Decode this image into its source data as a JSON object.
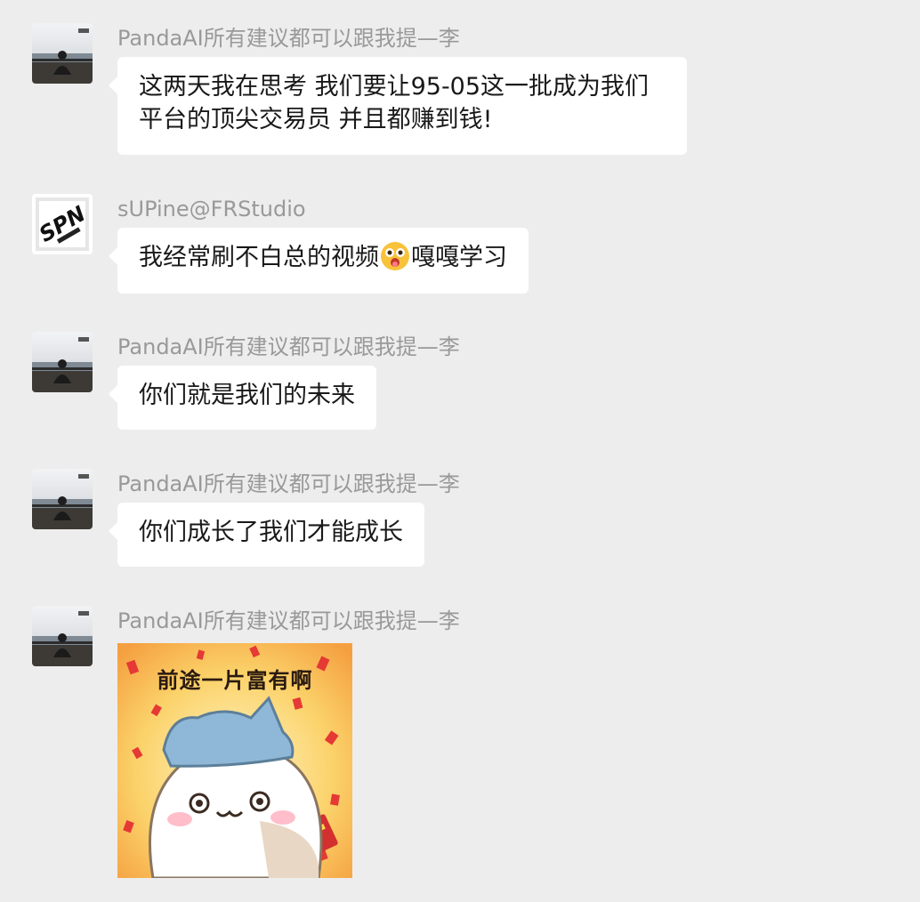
{
  "colors": {
    "background": "#ededed",
    "bubble": "#ffffff",
    "sender_name": "#999999",
    "message_text": "#191919"
  },
  "messages": [
    {
      "sender": "PandaAI所有建议都可以跟我提—李",
      "avatar": "photo-avatar-man-seaside",
      "text": "这两天我在思考 我们要让95-05这一批成为我们\n平台的顶尖交易员 并且都赚到钱!"
    },
    {
      "sender": "sUPine@FRStudio",
      "avatar": "spn-logo-avatar",
      "text_before": "我经常刷不白总的视频",
      "emoji": "drooling-face-emoji",
      "text_after": "嘎嘎学习"
    },
    {
      "sender": "PandaAI所有建议都可以跟我提—李",
      "avatar": "photo-avatar-man-seaside",
      "text": "你们就是我们的未来"
    },
    {
      "sender": "PandaAI所有建议都可以跟我提—李",
      "avatar": "photo-avatar-man-seaside",
      "text": "你们成长了我们才能成长"
    },
    {
      "sender": "PandaAI所有建议都可以跟我提—李",
      "avatar": "photo-avatar-man-seaside",
      "sticker": {
        "caption": "前途一片富有啊",
        "icon": "cat-sticker-icon"
      }
    }
  ]
}
